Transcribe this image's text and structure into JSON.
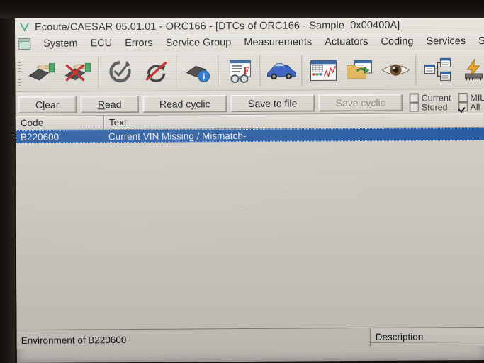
{
  "window": {
    "logo_icon": "v-logo-icon",
    "title": "Ecoute/CAESAR 05.01.01 - ORC166 - [DTCs of ORC166 - Sample_0x00400A]"
  },
  "menubar": {
    "system_icon": "mdi-window-icon",
    "items": [
      {
        "label": "System"
      },
      {
        "label": "ECU"
      },
      {
        "label": "Errors"
      },
      {
        "label": "Service Group"
      },
      {
        "label": "Measurements"
      },
      {
        "label": "Actuators"
      },
      {
        "label": "Coding"
      },
      {
        "label": "Services"
      },
      {
        "label": "Sequenc"
      }
    ]
  },
  "toolbar": {
    "buttons": [
      {
        "name": "connect-ecu-icon",
        "tooltip": "Connect ECU"
      },
      {
        "name": "disconnect-ecu-icon",
        "tooltip": "Disconnect ECU"
      },
      {
        "name": "refresh-check-icon",
        "tooltip": "Refresh"
      },
      {
        "name": "stop-cyclic-icon",
        "tooltip": "Stop cyclic"
      },
      {
        "name": "ecu-info-icon",
        "tooltip": "ECU information"
      },
      {
        "name": "read-faults-icon",
        "tooltip": "Read faults"
      },
      {
        "name": "vehicle-icon",
        "tooltip": "Vehicle"
      },
      {
        "name": "measurements-icon",
        "tooltip": "Measurements"
      },
      {
        "name": "open-project-icon",
        "tooltip": "Open project"
      },
      {
        "name": "monitor-eye-icon",
        "tooltip": "Monitor"
      },
      {
        "name": "sequence-icon",
        "tooltip": "Sequences"
      },
      {
        "name": "flash-ecu-icon",
        "tooltip": "Flash ECU"
      }
    ]
  },
  "actionbar": {
    "buttons": [
      {
        "name": "clear-button",
        "pre": "C",
        "accel": "l",
        "post": "ear",
        "disabled": false
      },
      {
        "name": "read-button",
        "pre": "",
        "accel": "R",
        "post": "ead",
        "disabled": false
      },
      {
        "name": "read-cyclic-button",
        "pre": "Read c",
        "accel": "y",
        "post": "clic",
        "disabled": false
      },
      {
        "name": "save-to-file-button",
        "pre": "S",
        "accel": "a",
        "post": "ve to file",
        "disabled": false
      },
      {
        "name": "save-cyclic-button",
        "pre": "Save c",
        "accel": "y",
        "post": "clic",
        "disabled": true
      }
    ],
    "checkboxes": [
      {
        "name": "current-checkbox",
        "label": "Current",
        "checked": false
      },
      {
        "name": "stored-checkbox",
        "label": "Stored",
        "checked": false
      },
      {
        "name": "mil-on-checkbox",
        "label": "MIL On",
        "checked": false
      },
      {
        "name": "all-checkbox",
        "label": "All",
        "checked": true
      },
      {
        "name": "extra-top-checkbox",
        "label": "",
        "checked": true
      },
      {
        "name": "extra-bottom-checkbox",
        "label": "",
        "checked": false
      }
    ]
  },
  "faultlist": {
    "columns": [
      {
        "label": "Code"
      },
      {
        "label": "Text"
      }
    ],
    "rows": [
      {
        "code": "B220600",
        "text": "Current VIN Missing / Mismatch-",
        "selected": true
      }
    ]
  },
  "lowerpane": {
    "environment_label": "Environment of B220600",
    "description_header": "Description"
  },
  "colors": {
    "selection_blue": "#2a5fa8",
    "window_face": "#d9d6ce",
    "titlebar": "#e9e7e0",
    "logo_green": "#2f9c7e"
  }
}
